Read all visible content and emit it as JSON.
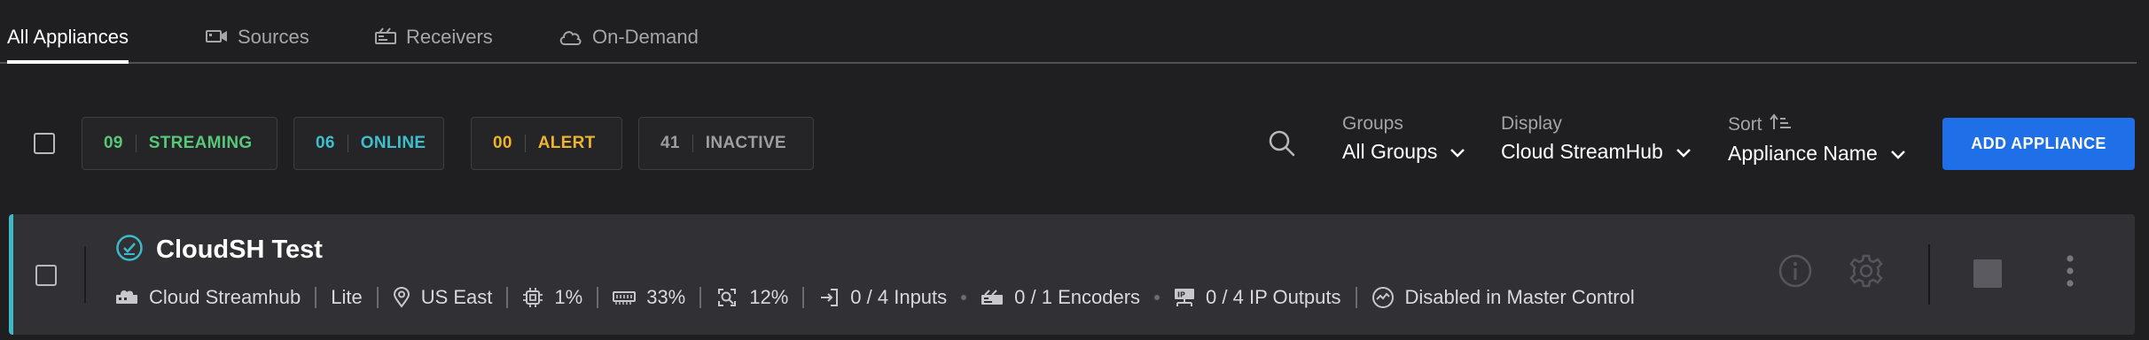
{
  "tabs": [
    {
      "label": "All Appliances",
      "icon": "",
      "active": true
    },
    {
      "label": "Sources",
      "icon": "sources-icon",
      "active": false
    },
    {
      "label": "Receivers",
      "icon": "receivers-icon",
      "active": false
    },
    {
      "label": "On-Demand",
      "icon": "cloud-icon",
      "active": false
    }
  ],
  "status_chips": [
    {
      "count": "09",
      "label": "STREAMING",
      "color": "#57c77a"
    },
    {
      "count": "06",
      "label": "ONLINE",
      "color": "#3dbfcc"
    },
    {
      "count": "00",
      "label": "ALERT",
      "color": "#eeb42e"
    },
    {
      "count": "41",
      "label": "INACTIVE",
      "color": "#9d9da3"
    }
  ],
  "filters": {
    "groups": {
      "label": "Groups",
      "value": "All Groups"
    },
    "display": {
      "label": "Display",
      "value": "Cloud StreamHub"
    },
    "sort": {
      "label": "Sort",
      "value": "Appliance Name"
    }
  },
  "add_button": "ADD APPLIANCE",
  "appliance": {
    "name": "CloudSH Test",
    "status_color": "#3dbac8",
    "type": "Cloud Streamhub",
    "edition": "Lite",
    "region": "US East",
    "cpu": "1%",
    "memory": "33%",
    "gpu": "12%",
    "inputs": "0 / 4 Inputs",
    "encoders": "0 / 1 Encoders",
    "ip_outputs": "0 / 4 IP Outputs",
    "master_control": "Disabled in Master Control"
  }
}
